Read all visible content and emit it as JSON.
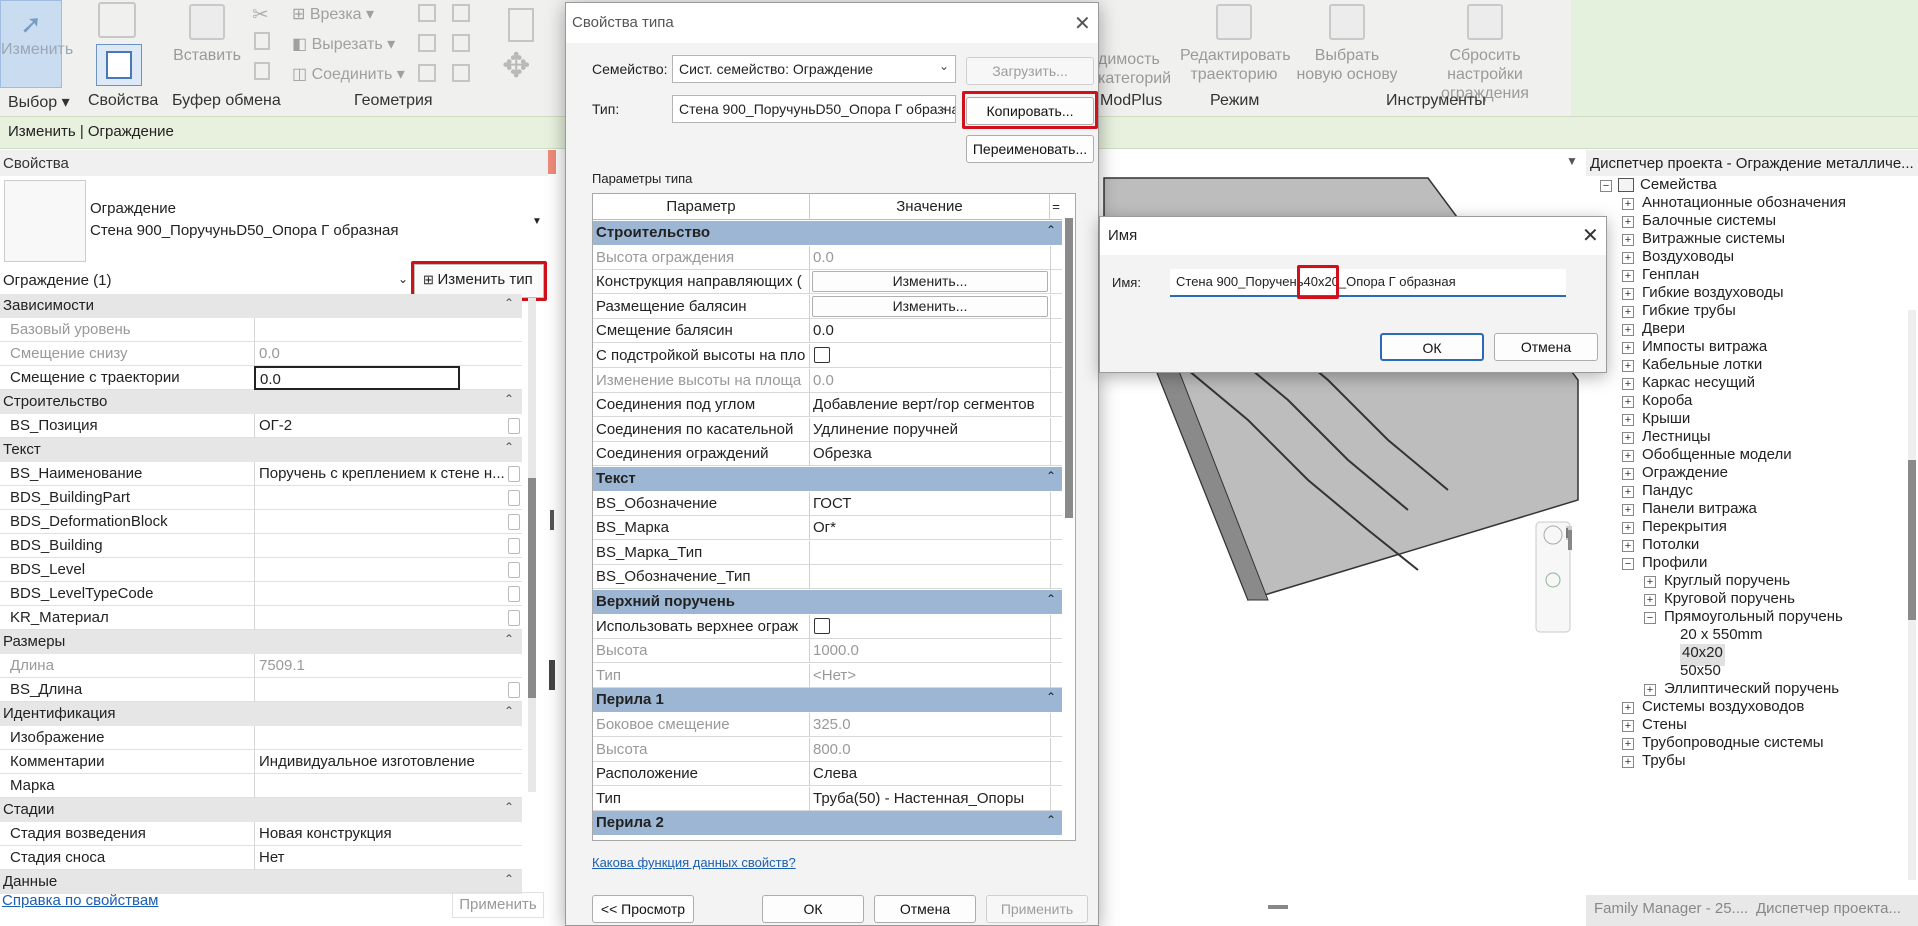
{
  "ribbon": {
    "modify_label": "Изменить",
    "paste_label": "Вставить",
    "notch_label": "Врезка",
    "cut_label": "Вырезать",
    "join_label": "Соединить",
    "modplus_label": "ModPlus",
    "ghost_label": "димость категорий",
    "edit_path_label": "Редактировать траекторию",
    "pick_host_label": "Выбрать новую основу",
    "reset_label": "Сбросить настройки ограждения",
    "panels": [
      "Выбор",
      "Свойства",
      "Буфер обмена",
      "Геометрия",
      "Режим",
      "Инструменты"
    ]
  },
  "context_bar": "Изменить | Ограждение",
  "properties": {
    "title": "Свойства",
    "family_name": "Ограждение",
    "type_name": "Стена 900_ПоручуньD50_Опора Г образная",
    "instance_selector": "Ограждение (1)",
    "edit_type_button": "Изменить тип",
    "rows": [
      {
        "group": "Зависимости"
      },
      {
        "k": "Базовый уровень",
        "v": "",
        "grey": true
      },
      {
        "k": "Смещение снизу",
        "v": "0.0",
        "grey": true
      },
      {
        "k": "Смещение с траектории",
        "v": "0.0",
        "edit": true
      },
      {
        "group": "Строительство"
      },
      {
        "k": "BS_Позиция",
        "v": "ОГ-2",
        "cb": true
      },
      {
        "group": "Текст"
      },
      {
        "k": "BS_Наименование",
        "v": "Поручень с креплением к стене н...",
        "cb": true
      },
      {
        "k": "BDS_BuildingPart",
        "v": "",
        "cb": true
      },
      {
        "k": "BDS_DeformationBlock",
        "v": "",
        "cb": true
      },
      {
        "k": "BDS_Building",
        "v": "",
        "cb": true
      },
      {
        "k": "BDS_Level",
        "v": "",
        "cb": true
      },
      {
        "k": "BDS_LevelTypeCode",
        "v": "",
        "cb": true
      },
      {
        "k": "KR_Материал",
        "v": "",
        "cb": true
      },
      {
        "group": "Размеры"
      },
      {
        "k": "Длина",
        "v": "7509.1",
        "grey": true
      },
      {
        "k": "BS_Длина",
        "v": "",
        "cb": true
      },
      {
        "group": "Идентификация"
      },
      {
        "k": "Изображение",
        "v": ""
      },
      {
        "k": "Комментарии",
        "v": "Индивидуальное изготовление"
      },
      {
        "k": "Марка",
        "v": ""
      },
      {
        "group": "Стадии"
      },
      {
        "k": "Стадия возведения",
        "v": "Новая конструкция"
      },
      {
        "k": "Стадия сноса",
        "v": "Нет"
      },
      {
        "group": "Данные"
      }
    ],
    "help_link": "Справка по свойствам",
    "apply_button": "Применить"
  },
  "project_browser": {
    "title": "Диспетчер проекта - Ограждение металличе...",
    "items": [
      {
        "label": "Семейства",
        "lvl": 0,
        "exp": "-",
        "folder": true
      },
      {
        "label": "Аннотационные обозначения",
        "lvl": 1,
        "exp": "+"
      },
      {
        "label": "Балочные системы",
        "lvl": 1,
        "exp": "+"
      },
      {
        "label": "Витражные системы",
        "lvl": 1,
        "exp": "+"
      },
      {
        "label": "Воздуховоды",
        "lvl": 1,
        "exp": "+"
      },
      {
        "label": "Генплан",
        "lvl": 1,
        "exp": "+"
      },
      {
        "label": "Гибкие воздуховоды",
        "lvl": 1,
        "exp": "+"
      },
      {
        "label": "Гибкие трубы",
        "lvl": 1,
        "exp": "+"
      },
      {
        "label": "Двери",
        "lvl": 1,
        "exp": "+"
      },
      {
        "label": "Импосты витража",
        "lvl": 1,
        "exp": "+"
      },
      {
        "label": "Кабельные лотки",
        "lvl": 1,
        "exp": "+"
      },
      {
        "label": "Каркас несущий",
        "lvl": 1,
        "exp": "+"
      },
      {
        "label": "Короба",
        "lvl": 1,
        "exp": "+"
      },
      {
        "label": "Крыши",
        "lvl": 1,
        "exp": "+"
      },
      {
        "label": "Лестницы",
        "lvl": 1,
        "exp": "+"
      },
      {
        "label": "Обобщенные модели",
        "lvl": 1,
        "exp": "+"
      },
      {
        "label": "Ограждение",
        "lvl": 1,
        "exp": "+"
      },
      {
        "label": "Пандус",
        "lvl": 1,
        "exp": "+"
      },
      {
        "label": "Панели витража",
        "lvl": 1,
        "exp": "+"
      },
      {
        "label": "Перекрытия",
        "lvl": 1,
        "exp": "+"
      },
      {
        "label": "Потолки",
        "lvl": 1,
        "exp": "+"
      },
      {
        "label": "Профили",
        "lvl": 1,
        "exp": "-"
      },
      {
        "label": "Круглый поручень",
        "lvl": 2,
        "exp": "+"
      },
      {
        "label": "Круговой поручень",
        "lvl": 2,
        "exp": "+"
      },
      {
        "label": "Прямоугольный поручень",
        "lvl": 2,
        "exp": "-"
      },
      {
        "label": "20 x 550mm",
        "lvl": 3,
        "exp": ""
      },
      {
        "label": "40x20",
        "lvl": 3,
        "exp": "",
        "selected": true
      },
      {
        "label": "50x50",
        "lvl": 3,
        "exp": ""
      },
      {
        "label": "Эллиптический поручень",
        "lvl": 2,
        "exp": "+"
      },
      {
        "label": "Системы воздуховодов",
        "lvl": 1,
        "exp": "+"
      },
      {
        "label": "Стены",
        "lvl": 1,
        "exp": "+"
      },
      {
        "label": "Трубопроводные системы",
        "lvl": 1,
        "exp": "+"
      },
      {
        "label": "Трубы",
        "lvl": 1,
        "exp": "+"
      }
    ]
  },
  "status_tabs": [
    "Family Manager - 25....",
    "Диспетчер проекта..."
  ],
  "type_dialog": {
    "title": "Свойства типа",
    "family_label": "Семейство:",
    "family_value": "Сист. семейство: Ограждение",
    "load_button": "Загрузить...",
    "type_label": "Тип:",
    "type_value": "Стена 900_ПоручуньD50_Опора Г образна",
    "copy_button": "Копировать...",
    "rename_button": "Переименовать...",
    "params_label": "Параметры типа",
    "col_param": "Параметр",
    "col_value": "Значение",
    "col_eq": "=",
    "rows": [
      {
        "group": "Строительство"
      },
      {
        "k": "Высота ограждения",
        "v": "0.0",
        "grey": true
      },
      {
        "k": "Конструкция направляющих (",
        "btn": "Изменить..."
      },
      {
        "k": "Размещение балясин",
        "btn": "Изменить..."
      },
      {
        "k": "Смещение балясин",
        "v": "0.0"
      },
      {
        "k": "С подстройкой высоты на пло",
        "check": true
      },
      {
        "k": "Изменение высоты на площа",
        "v": "0.0",
        "grey": true
      },
      {
        "k": "Соединения под углом",
        "v": "Добавление верт/гор сегментов"
      },
      {
        "k": "Соединения по касательной",
        "v": "Удлинение поручней"
      },
      {
        "k": "Соединения ограждений",
        "v": "Обрезка"
      },
      {
        "group": "Текст"
      },
      {
        "k": "BS_Обозначение",
        "v": "ГОСТ",
        "sc": true
      },
      {
        "k": "BS_Марка",
        "v": "Ог*",
        "sc": true
      },
      {
        "k": "BS_Марка_Тип",
        "v": "",
        "sc": true
      },
      {
        "k": "BS_Обозначение_Тип",
        "v": "",
        "sc": true
      },
      {
        "group": "Верхний поручень"
      },
      {
        "k": "Использовать верхнее ограж",
        "check": true
      },
      {
        "k": "Высота",
        "v": "1000.0",
        "grey": true
      },
      {
        "k": "Тип",
        "v": "<Нет>",
        "grey": true
      },
      {
        "group": "Перила 1"
      },
      {
        "k": "Боковое смещение",
        "v": "325.0",
        "grey": true
      },
      {
        "k": "Высота",
        "v": "800.0",
        "grey": true
      },
      {
        "k": "Расположение",
        "v": "Слева"
      },
      {
        "k": "Тип",
        "v": "Труба(50) - Настенная_Опоры"
      },
      {
        "group": "Перила 2"
      }
    ],
    "help_link": "Какова функция данных свойств?",
    "preview_button": "<< Просмотр",
    "ok_button": "ОК",
    "cancel_button": "Отмена",
    "apply_button": "Применить"
  },
  "name_dialog": {
    "title": "Имя",
    "name_label": "Имя:",
    "name_value": "Стена 900_Поручень40x20_Опора Г образная",
    "ok_button": "ОК",
    "cancel_button": "Отмена"
  },
  "colors": {
    "highlight": "#d0101a",
    "table_group": "#9cb6d3",
    "ribbon_green": "#e4f1dc"
  }
}
